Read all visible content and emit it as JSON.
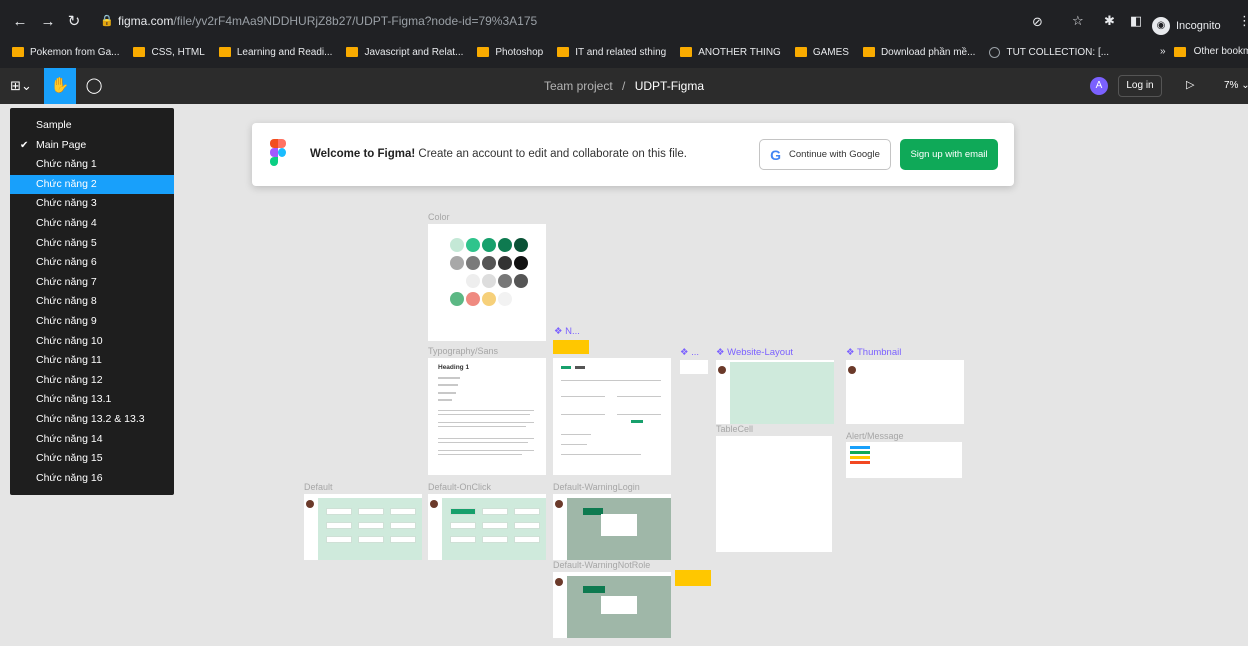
{
  "browser": {
    "url_domain": "figma.com",
    "url_path": "/file/yv2rF4mAa9NDDHURjZ8b27/UDPT-Figma?node-id=79%3A175",
    "profile_label": "Incognito",
    "bookmarks": [
      {
        "label": "Pokemon from Ga...",
        "kind": "folder"
      },
      {
        "label": "CSS, HTML",
        "kind": "folder"
      },
      {
        "label": "Learning and Readi...",
        "kind": "folder"
      },
      {
        "label": "Javascript and Relat...",
        "kind": "folder"
      },
      {
        "label": "Photoshop",
        "kind": "folder"
      },
      {
        "label": "IT and related sthing",
        "kind": "folder"
      },
      {
        "label": "ANOTHER THING",
        "kind": "folder"
      },
      {
        "label": "GAMES",
        "kind": "folder"
      },
      {
        "label": "Download phần mề...",
        "kind": "folder"
      },
      {
        "label": "TUT COLLECTION: [...",
        "kind": "globe"
      }
    ],
    "bookmarks_overflow": "»",
    "other_bookmarks": "Other bookmark"
  },
  "figma": {
    "team": "Team project",
    "separator": "/",
    "file_name": "UDPT-Figma",
    "avatar_letter": "A",
    "login_label": "Log in",
    "zoom": "7%",
    "accent": "#18a0fb"
  },
  "pages_menu": {
    "items": [
      {
        "label": "Sample"
      },
      {
        "label": "Main Page",
        "checked": "✔"
      },
      {
        "label": "Chức năng 1"
      },
      {
        "label": "Chức năng 2"
      },
      {
        "label": "Chức năng 3"
      },
      {
        "label": "Chức năng 4"
      },
      {
        "label": "Chức năng 5"
      },
      {
        "label": "Chức năng 6"
      },
      {
        "label": "Chức năng 7"
      },
      {
        "label": "Chức năng 8"
      },
      {
        "label": "Chức năng 9"
      },
      {
        "label": "Chức năng 10"
      },
      {
        "label": "Chức năng 11"
      },
      {
        "label": "Chức năng 12"
      },
      {
        "label": "Chức năng 13.1"
      },
      {
        "label": "Chức năng 13.2 & 13.3"
      },
      {
        "label": "Chức năng 14"
      },
      {
        "label": "Chức năng 15"
      },
      {
        "label": "Chức năng 16"
      }
    ]
  },
  "welcome": {
    "bold": "Welcome to Figma!",
    "text": " Create an account to edit and collaborate on this file.",
    "google_button": "Continue with Google",
    "email_button": "Sign up with email",
    "email_button_color": "#0fa958"
  },
  "canvas_labels": {
    "color": "Color",
    "typography": "Typography/Sans",
    "nav_comp": "❖ N...",
    "dots_comp": "❖ ...",
    "website_layout": "❖ Website-Layout",
    "thumbnail": "❖ Thumbnail",
    "table_cell": "TableCell",
    "alert_message": "Alert/Message",
    "default": "Default",
    "default_onclick": "Default-OnClick",
    "default_warning_login": "Default-WarningLogin",
    "default_warning_not_role": "Default-WarningNotRole",
    "heading_1": "Heading 1"
  }
}
